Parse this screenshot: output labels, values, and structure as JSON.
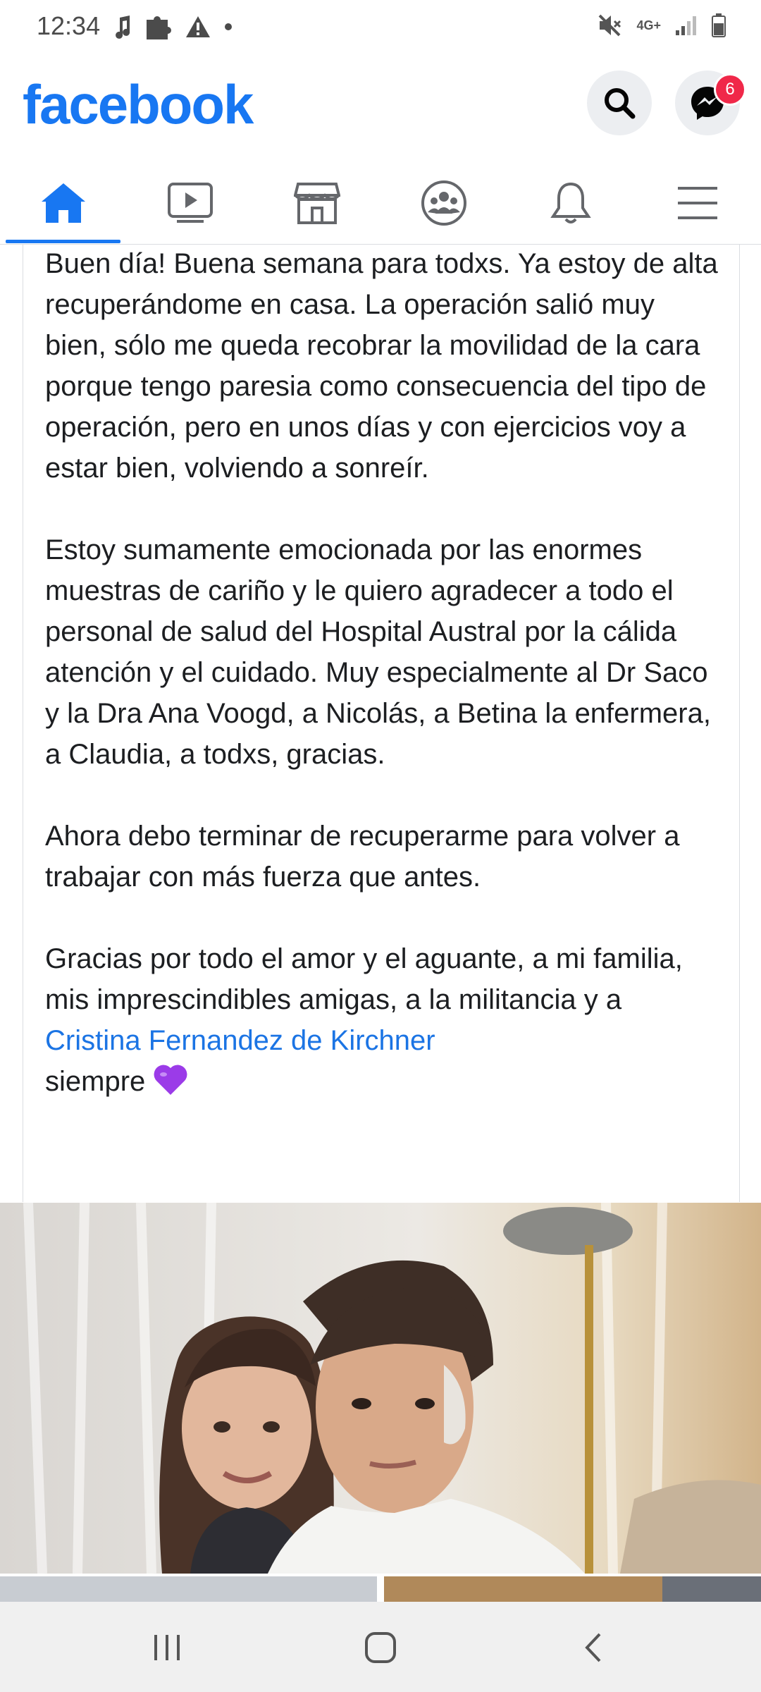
{
  "status_bar": {
    "time": "12:34",
    "network": "4G+",
    "icons": [
      "music-note-icon",
      "puzzle-icon",
      "warning-icon",
      "dot-icon",
      "mute-icon",
      "signal-icon",
      "battery-icon"
    ]
  },
  "header": {
    "logo": "facebook",
    "messenger_badge": "6",
    "accent_color": "#1877f2"
  },
  "tabs": [
    {
      "name": "home",
      "icon": "home-icon",
      "active": true
    },
    {
      "name": "watch",
      "icon": "video-icon",
      "active": false
    },
    {
      "name": "marketplace",
      "icon": "store-icon",
      "active": false
    },
    {
      "name": "groups",
      "icon": "groups-icon",
      "active": false
    },
    {
      "name": "notifications",
      "icon": "bell-icon",
      "active": false
    },
    {
      "name": "menu",
      "icon": "menu-icon",
      "active": false
    }
  ],
  "post": {
    "para1": "Buen día! Buena semana para todxs. Ya estoy de alta recuperándome en casa. La operación salió muy bien, sólo me queda recobrar la movilidad de la cara porque tengo paresia como consecuencia del tipo de operación, pero en unos días y con ejercicios voy a estar bien, volviendo a sonreír.",
    "para2": "Estoy sumamente emocionada por las enormes muestras de cariño y le quiero agradecer a todo el personal de salud del Hospital Austral por la cálida atención y el cuidado. Muy especialmente al Dr Saco y la Dra Ana Voogd, a Nicolás, a Betina la enfermera, a Claudia, a todxs, gracias.",
    "para3": "Ahora debo terminar de recuperarme para volver a trabajar con más fuerza que antes.",
    "para4_start": "Gracias por todo el amor y el aguante, a mi familia, mis imprescindibles amigas, a la militancia y a ",
    "mention": "Cristina Fernandez de Kirchner",
    "para4_end": "siempre"
  },
  "nav_bar": {
    "items": [
      "recents-icon",
      "home-button-icon",
      "back-icon"
    ]
  }
}
